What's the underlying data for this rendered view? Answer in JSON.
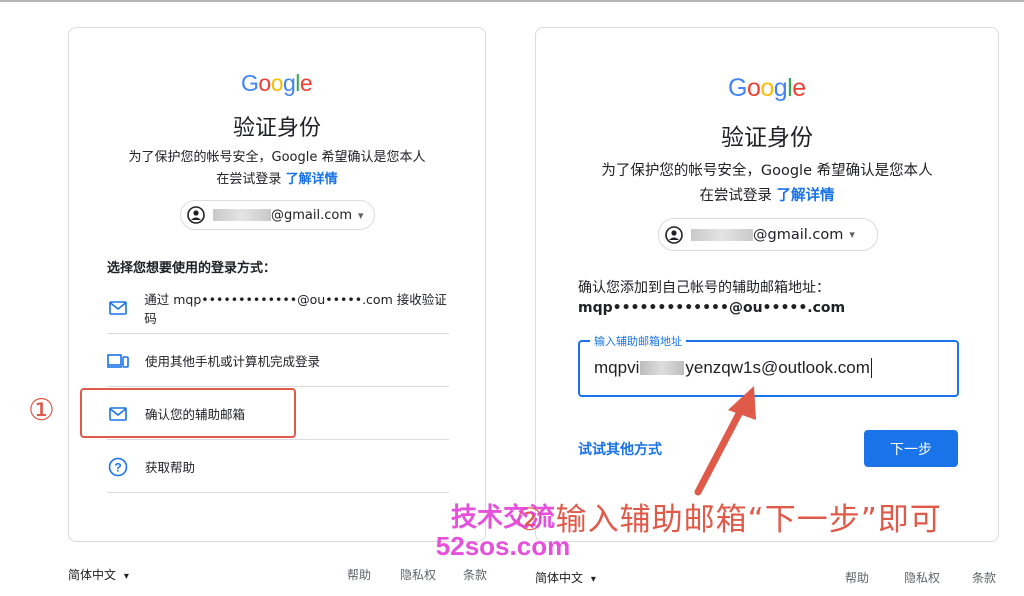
{
  "left_card": {
    "logo": [
      "G",
      "o",
      "o",
      "g",
      "l",
      "e"
    ],
    "title": "验证身份",
    "subtitle_line1": "为了保护您的帐号安全，Google 希望确认是您本人",
    "subtitle_line2_prefix": "在尝试登录",
    "learn_more": "了解详情",
    "account_suffix": "@gmail.com",
    "choose_label": "选择您想要使用的登录方式：",
    "options": [
      {
        "label": "通过 mqp•••••••••••••@ou•••••.com 接收验证码",
        "icon": "mail-icon"
      },
      {
        "label": "使用其他手机或计算机完成登录",
        "icon": "devices-icon"
      },
      {
        "label": "确认您的辅助邮箱",
        "icon": "mail-icon"
      },
      {
        "label": "获取帮助",
        "icon": "help-icon"
      }
    ],
    "footer": {
      "language": "简体中文",
      "help": "帮助",
      "privacy": "隐私权",
      "terms": "条款"
    }
  },
  "right_card": {
    "logo": [
      "G",
      "o",
      "o",
      "g",
      "l",
      "e"
    ],
    "title": "验证身份",
    "subtitle_line1": "为了保护您的帐号安全，Google 希望确认是您本人",
    "subtitle_line2_prefix": "在尝试登录",
    "learn_more": "了解详情",
    "account_suffix": "@gmail.com",
    "confirm_text": "确认您添加到自己帐号的辅助邮箱地址：",
    "masked_email": "mqp•••••••••••••@ou•••••.com",
    "field_label": "输入辅助邮箱地址",
    "field_value_prefix": "mqpvi",
    "field_value_suffix": "yenzqw1s@outlook.com",
    "try_other": "试试其他方式",
    "next": "下一步",
    "footer": {
      "language": "简体中文",
      "help": "帮助",
      "privacy": "隐私权",
      "terms": "条款"
    }
  },
  "annotations": {
    "step1": "①",
    "step2": "② 输入辅助邮箱“下一步”即可"
  },
  "watermark": {
    "line1": "技术交流",
    "line2": "52sos.com"
  },
  "colors": {
    "accent": "#1a73e8",
    "annotation": "#e05a4a",
    "watermark": "#e43fd8"
  }
}
